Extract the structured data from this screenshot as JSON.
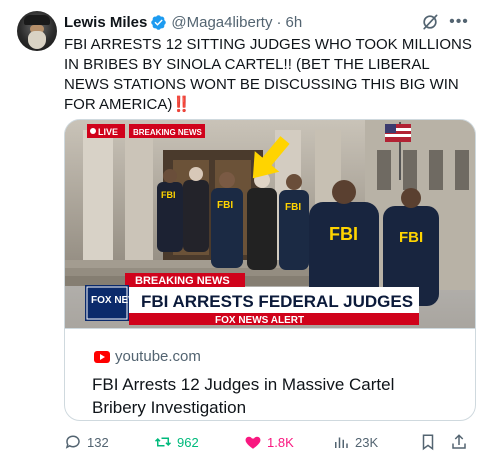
{
  "author": {
    "name": "Lewis Miles",
    "handle": "@Maga4liberty",
    "separator": "·",
    "time": "6h",
    "verified": true,
    "verified_color": "#1d9bf0"
  },
  "tweet": {
    "text": "FBI ARRESTS 12 SITTING JUDGES WHO TOOK MILLIONS IN BRIBES BY SINOLA CARTEL!! (BET THE LIBERAL NEWS STATIONS WONT BE DISCUSSING THIS BIG WIN FOR AMERICA)",
    "emoji": "‼️"
  },
  "card": {
    "domain": "youtube.com",
    "title": "FBI Arrests 12 Judges in Massive Cartel Bribery Investigation",
    "image": {
      "live_label": "LIVE",
      "breaking_tag": "BREAKING NEWS",
      "lower_third_tag": "BREAKING NEWS",
      "headline": "FBI ARRESTS FEDERAL JUDGES",
      "network_logo": "FOX NEWS",
      "ticker": "FOX NEWS ALERT",
      "jacket_text": "FBI"
    }
  },
  "actions": {
    "replies": "132",
    "reposts": "962",
    "likes": "1.8K",
    "views": "23K"
  },
  "colors": {
    "text": "#0f1419",
    "secondary": "#536471",
    "repost_active": "#00ba7c",
    "like_active": "#f91880",
    "fox_red": "#d0021b",
    "fox_blue": "#0b2a6b",
    "arrow_yellow": "#ffd400"
  }
}
